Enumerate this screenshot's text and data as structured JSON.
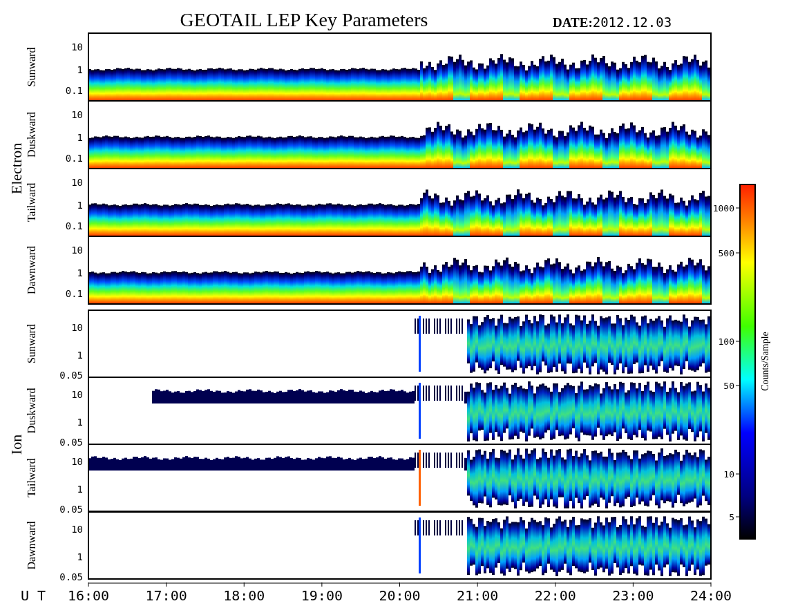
{
  "title": "GEOTAIL LEP Key Parameters",
  "date": {
    "label": "DATE:",
    "value": "2012.12.03"
  },
  "groups": [
    {
      "name": "Electron",
      "kind": "electron",
      "panels": [
        {
          "label": "Sunward",
          "yticks": [
            "10",
            "1",
            "0.1"
          ]
        },
        {
          "label": "Duskward",
          "yticks": [
            "10",
            "1",
            "0.1"
          ]
        },
        {
          "label": "Tailward",
          "yticks": [
            "10",
            "1",
            "0.1"
          ]
        },
        {
          "label": "Dawnward",
          "yticks": [
            "10",
            "1",
            "0.1"
          ]
        }
      ]
    },
    {
      "name": "Ion",
      "kind": "ion",
      "panels": [
        {
          "label": "Sunward",
          "yticks": [
            "10",
            "1",
            "0.05"
          ]
        },
        {
          "label": "Duskward",
          "yticks": [
            "10",
            "1",
            "0.05"
          ]
        },
        {
          "label": "Tailward",
          "yticks": [
            "10",
            "1",
            "0.05"
          ]
        },
        {
          "label": "Dawnward",
          "yticks": [
            "10",
            "1",
            "0.05"
          ]
        }
      ]
    }
  ],
  "x_axis": {
    "label": "U T",
    "ticks": [
      "16:00",
      "17:00",
      "18:00",
      "19:00",
      "20:00",
      "21:00",
      "22:00",
      "23:00",
      "24:00"
    ]
  },
  "colorbar": {
    "label": "Counts/Sample",
    "ticks": [
      "1000",
      "500",
      "100",
      "50",
      "10",
      "5"
    ]
  }
}
